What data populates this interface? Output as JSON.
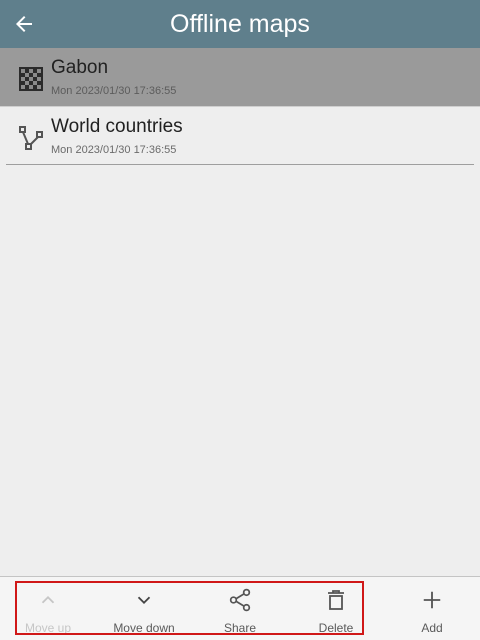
{
  "appbar": {
    "title": "Offline maps",
    "back_icon": "arrow-left-icon"
  },
  "maps": [
    {
      "name": "Gabon",
      "date": "Mon 2023/01/30 17:36:55",
      "icon": "checkerboard-icon",
      "selected": true
    },
    {
      "name": "World countries",
      "date": "Mon 2023/01/30 17:36:55",
      "icon": "vector-icon",
      "selected": false
    }
  ],
  "toolbar": {
    "move_up": {
      "label": "Move up",
      "icon": "chevron-up-icon",
      "enabled": false
    },
    "move_down": {
      "label": "Move down",
      "icon": "chevron-down-icon",
      "enabled": true
    },
    "share": {
      "label": "Share",
      "icon": "share-icon",
      "enabled": true
    },
    "delete": {
      "label": "Delete",
      "icon": "trash-icon",
      "enabled": true
    },
    "add": {
      "label": "Add",
      "icon": "plus-icon",
      "enabled": true
    }
  },
  "colors": {
    "appbar": "#5f7f8c",
    "selected_row": "#9a9a9a",
    "background": "#eeeeee",
    "highlight_box": "#d01818"
  }
}
